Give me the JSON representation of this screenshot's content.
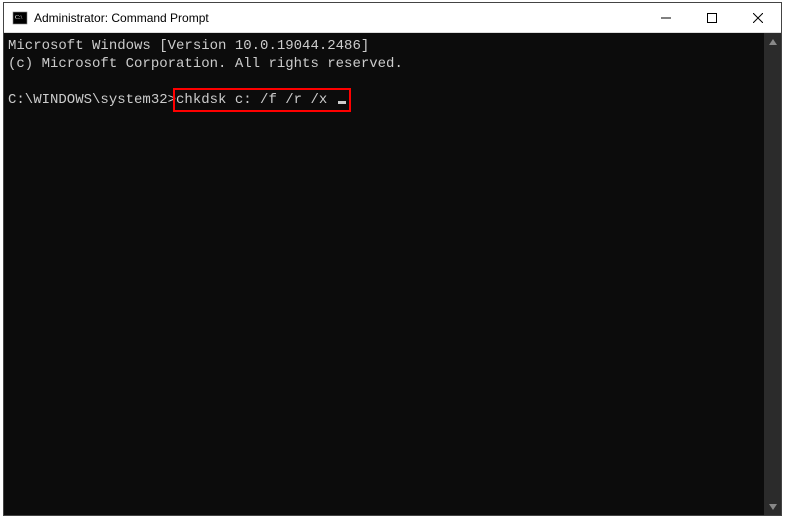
{
  "window": {
    "title": "Administrator: Command Prompt"
  },
  "terminal": {
    "line1": "Microsoft Windows [Version 10.0.19044.2486]",
    "line2": "(c) Microsoft Corporation. All rights reserved.",
    "prompt": "C:\\WINDOWS\\system32>",
    "command": "chkdsk c: /f /r /x "
  }
}
